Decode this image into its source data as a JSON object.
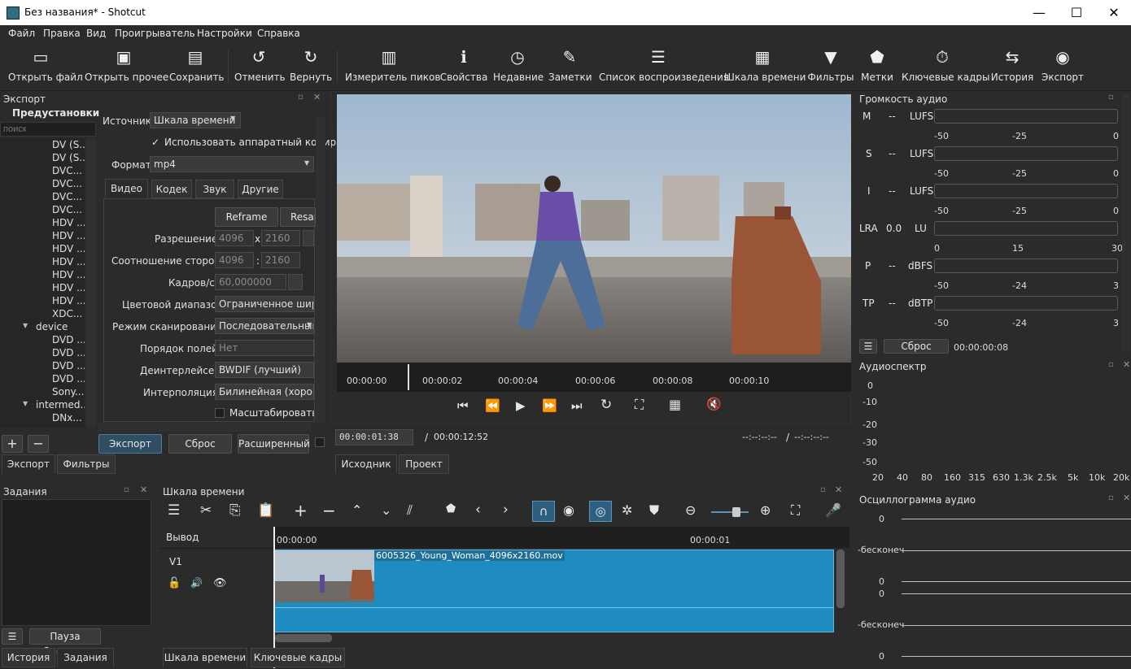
{
  "window": {
    "title": "Без названия* - Shotcut",
    "min": "—",
    "max": "☐",
    "close": "✕"
  },
  "menu": [
    "Файл",
    "Правка",
    "Вид",
    "Проигрыватель",
    "Настройки",
    "Справка"
  ],
  "toolbar": [
    {
      "icon": "folder-open-icon",
      "label": "Открыть файл"
    },
    {
      "icon": "open-other-icon",
      "label": "Открыть прочее"
    },
    {
      "icon": "save-icon",
      "label": "Сохранить"
    },
    {
      "icon": "undo-icon",
      "label": "Отменить"
    },
    {
      "icon": "redo-icon",
      "label": "Вернуть"
    },
    {
      "icon": "peak-meter-icon",
      "label": "Измеритель пиков"
    },
    {
      "icon": "info-icon",
      "label": "Свойства"
    },
    {
      "icon": "clock-icon",
      "label": "Недавние"
    },
    {
      "icon": "notes-icon",
      "label": "Заметки"
    },
    {
      "icon": "playlist-icon",
      "label": "Список воспроизведения"
    },
    {
      "icon": "timeline-icon",
      "label": "Шкала времени"
    },
    {
      "icon": "filter-icon",
      "label": "Фильтры"
    },
    {
      "icon": "marker-icon",
      "label": "Метки"
    },
    {
      "icon": "keyframes-icon",
      "label": "Ключевые кадры"
    },
    {
      "icon": "history-icon",
      "label": "История"
    },
    {
      "icon": "export-icon",
      "label": "Экспорт"
    }
  ],
  "export": {
    "title": "Экспорт",
    "presets_header": "Предустановки",
    "search_placeholder": "поиск",
    "presets": [
      "DV (S...",
      "DV (S...",
      "DVC...",
      "DVC...",
      "DVC...",
      "DVC...",
      "HDV ...",
      "HDV ...",
      "HDV ...",
      "HDV ...",
      "HDV ...",
      "HDV ...",
      "HDV ...",
      "XDC...",
      "device",
      "DVD ...",
      "DVD ...",
      "DVD ...",
      "DVD ...",
      "Sony...",
      "intermed...",
      "DNx..."
    ],
    "source_label": "Источник",
    "source_value": "Шкала времени",
    "hw_encoder": "Использовать аппаратный кодир",
    "format_label": "Формат",
    "format_value": "mp4",
    "tabs": [
      "Видео",
      "Кодек",
      "Звук",
      "Другие"
    ],
    "reframe": "Reframe",
    "resample": "Resar",
    "resolution_label": "Разрешение",
    "res_w": "4096",
    "res_x": "x",
    "res_h": "2160",
    "aspect_label": "Соотношение сторон",
    "aspect_w": "4096",
    "aspect_sep": ":",
    "aspect_h": "2160",
    "fps_label": "Кадров/с",
    "fps_value": "60,000000",
    "range_label": "Цветовой диапазон",
    "range_value": "Ограниченное широ",
    "scan_label": "Режим сканирования",
    "scan_value": "Последовательный",
    "field_label": "Порядок полей",
    "field_value": "Нет",
    "deint_label": "Деинтерлейсер",
    "deint_value": "BWDIF (лучший)",
    "interp_label": "Интерполяция",
    "interp_value": "Билинейная (хорошо",
    "scale_label": "Масштабировать п",
    "export_btn": "Экспорт",
    "reset_btn": "Сброс",
    "advanced_btn": "Расширенный",
    "bottom_tabs": [
      "Экспорт",
      "Фильтры"
    ]
  },
  "player": {
    "ruler": [
      "00:00:00",
      "00:00:02",
      "00:00:04",
      "00:00:06",
      "00:00:08",
      "00:00:10"
    ],
    "position": "00:00:01:38",
    "duration_sep": "/",
    "duration": "00:00:12:52",
    "in_point": "--:--:--:--",
    "io_sep": "/",
    "out_point": "--:--:--:--",
    "tabs": [
      "Исходник",
      "Проект"
    ]
  },
  "loudness": {
    "title": "Громкость аудио",
    "rows": [
      {
        "key": "M",
        "val": "--",
        "unit": "LUFS",
        "scale": [
          "-50",
          "-25",
          "0"
        ]
      },
      {
        "key": "S",
        "val": "--",
        "unit": "LUFS",
        "scale": [
          "-50",
          "-25",
          "0"
        ]
      },
      {
        "key": "I",
        "val": "--",
        "unit": "LUFS",
        "scale": [
          "-50",
          "-25",
          "0"
        ]
      },
      {
        "key": "LRA",
        "val": "0.0",
        "unit": "LU",
        "scale": [
          "0",
          "15",
          "30"
        ]
      },
      {
        "key": "P",
        "val": "--",
        "unit": "dBFS",
        "scale": [
          "-50",
          "-24",
          "3"
        ]
      },
      {
        "key": "TP",
        "val": "--",
        "unit": "dBTP",
        "scale": [
          "-50",
          "-24",
          "3"
        ]
      }
    ],
    "reset": "Сброс",
    "time": "00:00:00:08"
  },
  "spectrum": {
    "title": "Аудиоспектр",
    "y": [
      "0",
      "-10",
      "-20",
      "-30",
      "-50"
    ],
    "x": [
      "20",
      "40",
      "80",
      "160",
      "315",
      "630",
      "1.3k",
      "2.5k",
      "5k",
      "10k",
      "20k"
    ]
  },
  "waveform": {
    "title": "Осциллограмма аудио",
    "labels": [
      "0",
      "-бесконеч",
      "0",
      "0",
      "-бесконеч",
      "0"
    ]
  },
  "jobs": {
    "title": "Задания",
    "pause": "Пауза Очереди",
    "tabs": [
      "История",
      "Задания"
    ]
  },
  "timeline": {
    "title": "Шкала времени",
    "output": "Вывод",
    "track": "V1",
    "ruler": [
      "00:00:00",
      "00:00:01"
    ],
    "clip": "6005326_Young_Woman_4096x2160.mov",
    "tabs": [
      "Шкала времени",
      "Ключевые кадры"
    ]
  }
}
